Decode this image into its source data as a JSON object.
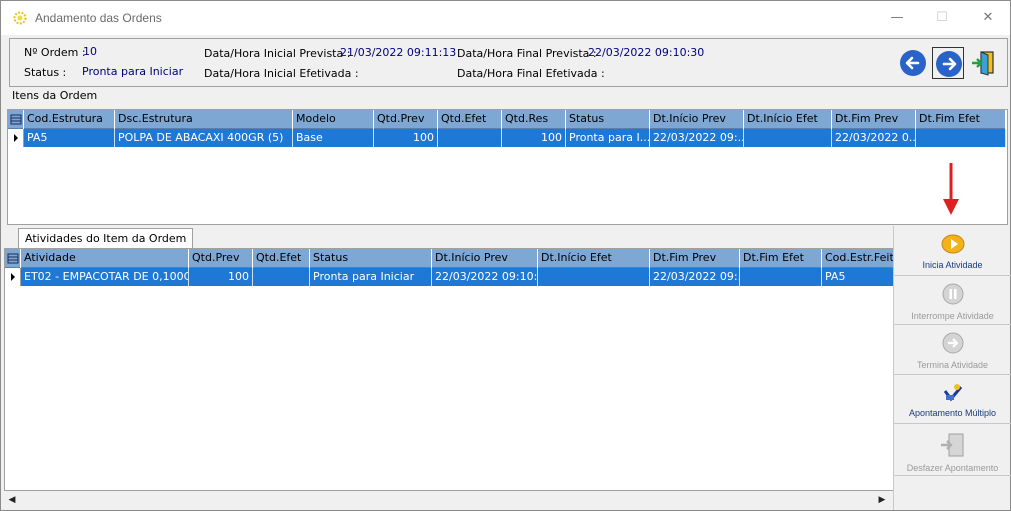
{
  "window": {
    "title": "Andamento das Ordens",
    "minimize_glyph": "—",
    "maximize_glyph": "☐",
    "close_glyph": "✕"
  },
  "header": {
    "ordem_label": "Nº Ordem :",
    "ordem_value": "10",
    "status_label": "Status :",
    "status_value": "Pronta para Iniciar",
    "inicial_prevista_label": "Data/Hora Inicial Prevista :",
    "inicial_prevista_value": "21/03/2022 09:11:13",
    "inicial_efetivada_label": "Data/Hora Inicial Efetivada :",
    "final_prevista_label": "Data/Hora Final Prevista :",
    "final_prevista_value": "22/03/2022 09:10:30",
    "final_efetivada_label": "Data/Hora Final Efetivada :"
  },
  "itens": {
    "section_label": "Itens da Ordem",
    "columns": [
      "Cod.Estrutura",
      "Dsc.Estrutura",
      "Modelo",
      "Qtd.Prev",
      "Qtd.Efet",
      "Qtd.Res",
      "Status",
      "Dt.Início Prev",
      "Dt.Início Efet",
      "Dt.Fim Prev",
      "Dt.Fim Efet"
    ],
    "rows": [
      [
        "PA5",
        "POLPA DE ABACAXI 400GR  (5)",
        "Base",
        "100",
        "",
        "100",
        "Pronta para I...",
        "22/03/2022 09:...",
        "",
        "22/03/2022 0...",
        ""
      ]
    ]
  },
  "atividades": {
    "tab_label": "Atividades do Item da Ordem",
    "columns": [
      "Atividade",
      "Qtd.Prev",
      "Qtd.Efet",
      "Status",
      "Dt.Início Prev",
      "Dt.Início Efet",
      "Dt.Fim Prev",
      "Dt.Fim Efet",
      "Cod.Estr.Feita"
    ],
    "rows": [
      [
        "ET02 - EMPACOTAR DE 0,100G...",
        "100",
        "",
        "Pronta para Iniciar",
        "22/03/2022 09:10:30",
        "",
        "22/03/2022 09:...",
        "",
        "PA5"
      ]
    ]
  },
  "actions": {
    "inicia": "Inicia Atividade",
    "interrompe": "Interrompe Atividade",
    "termina": "Termina Atividade",
    "apontamento": "Apontamento Múltiplo",
    "desfazer": "Desfazer Apontamento"
  },
  "icons": {
    "app": "gear-icon",
    "prev": "arrow-left-icon",
    "next": "arrow-right-icon",
    "exit": "exit-door-icon",
    "grid_menu": "grid-menu-icon",
    "row_pointer": "row-pointer-icon"
  },
  "colors": {
    "grid_header": "#7fa7d3",
    "selection": "#1e78d6",
    "nav_blue": "#2a63c8",
    "value_text": "#000080",
    "annotation_red": "#e02020"
  }
}
